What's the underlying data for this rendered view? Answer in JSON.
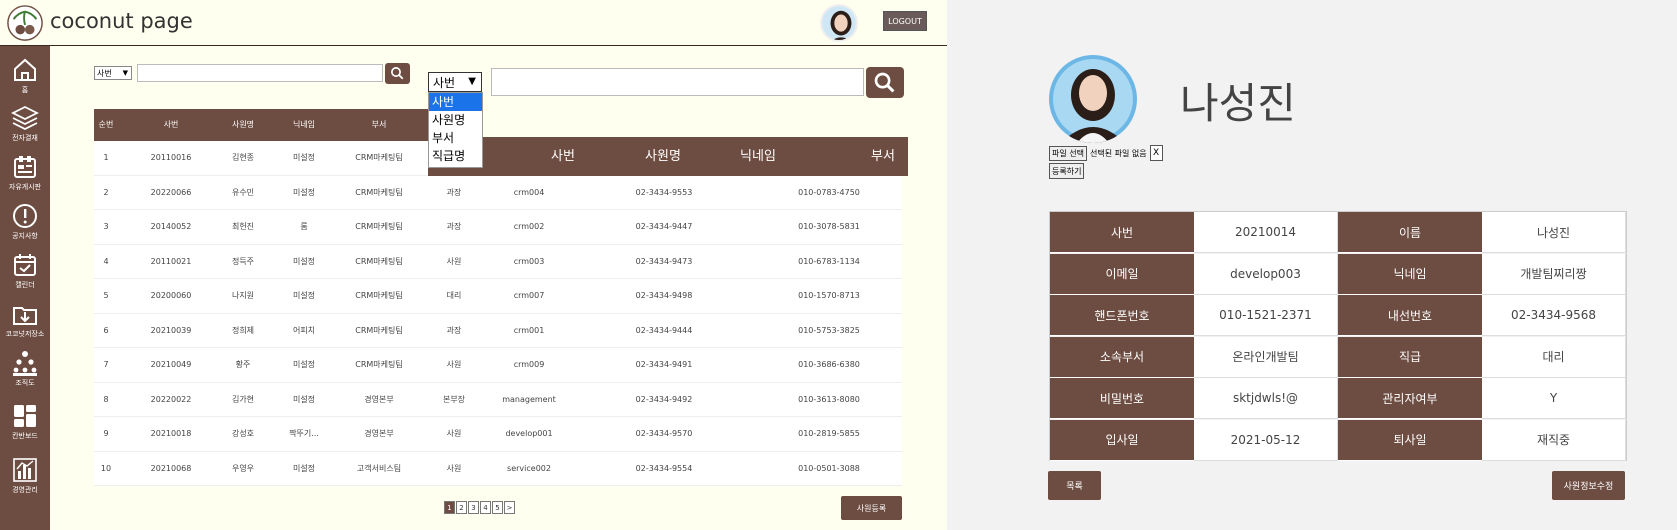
{
  "header": {
    "brand": "coconut page",
    "logout_label": "LOGOUT"
  },
  "sidebar": {
    "items": [
      {
        "label": "홈",
        "icon": "home-icon"
      },
      {
        "label": "전자결재",
        "icon": "layers-icon"
      },
      {
        "label": "자유게시판",
        "icon": "board-icon"
      },
      {
        "label": "공지사항",
        "icon": "alert-icon"
      },
      {
        "label": "캘린더",
        "icon": "calendar-icon"
      },
      {
        "label": "코코넛저장소",
        "icon": "folder-download-icon"
      },
      {
        "label": "조직도",
        "icon": "org-chart-icon"
      },
      {
        "label": "칸반보드",
        "icon": "kanban-icon"
      },
      {
        "label": "경영관리",
        "icon": "bar-chart-icon"
      }
    ]
  },
  "search": {
    "small_select_value": "사번",
    "big_select_value": "사번",
    "big_dropdown_options": [
      "사번",
      "사원명",
      "부서",
      "직급명"
    ]
  },
  "emp_table": {
    "head1": [
      "순번",
      "사번",
      "사원명",
      "닉네임",
      "부서"
    ],
    "head2": [
      "사번",
      "사원명",
      "닉네임",
      "부서"
    ],
    "rows": [
      [
        "1",
        "20110016",
        "김현종",
        "미설정",
        "CRM마케팅팀",
        "",
        "",
        "",
        ""
      ],
      [
        "2",
        "20220066",
        "유수민",
        "미설정",
        "CRM마케팅팀",
        "과장",
        "crm004",
        "02-3434-9553",
        "010-0783-4750"
      ],
      [
        "3",
        "20140052",
        "최헌진",
        "롬",
        "CRM마케팅팀",
        "과장",
        "crm002",
        "02-3434-9447",
        "010-3078-5831"
      ],
      [
        "4",
        "20110021",
        "정득주",
        "미설정",
        "CRM마케팅팀",
        "사원",
        "crm003",
        "02-3434-9473",
        "010-6783-1134"
      ],
      [
        "5",
        "20200060",
        "나지원",
        "미설정",
        "CRM마케팅팀",
        "대리",
        "crm007",
        "02-3434-9498",
        "010-1570-8713"
      ],
      [
        "6",
        "20210039",
        "정희제",
        "어피치",
        "CRM마케팅팀",
        "과장",
        "crm001",
        "02-3434-9444",
        "010-5753-3825"
      ],
      [
        "7",
        "20210049",
        "황주",
        "미설정",
        "CRM마케팅팀",
        "사원",
        "crm009",
        "02-3434-9491",
        "010-3686-6380"
      ],
      [
        "8",
        "20220022",
        "김가현",
        "미설정",
        "경영본부",
        "본부장",
        "management",
        "02-3434-9492",
        "010-3613-8080"
      ],
      [
        "9",
        "20210018",
        "강성호",
        "짝뚜기...",
        "경영본부",
        "사원",
        "develop001",
        "02-3434-9570",
        "010-2819-5855"
      ],
      [
        "10",
        "20210068",
        "우영우",
        "미설정",
        "고객서비스팀",
        "사원",
        "service002",
        "02-3434-9554",
        "010-0501-3088"
      ]
    ]
  },
  "pagination": {
    "pages": [
      "1",
      "2",
      "3",
      "4",
      "5",
      ">"
    ]
  },
  "register_label": "사원등록",
  "profile": {
    "name": "나성진",
    "file_button": "파일 선택",
    "file_status": "선택된 파일 없음",
    "file_clear": "X",
    "upload_label": "등록하기"
  },
  "detail": {
    "rows": [
      [
        "사번",
        "20210014",
        "이름",
        "나성진"
      ],
      [
        "이메일",
        "develop003",
        "닉네임",
        "개발팀찌리짱"
      ],
      [
        "핸드폰번호",
        "010-1521-2371",
        "내선번호",
        "02-3434-9568"
      ],
      [
        "소속부서",
        "온라인개발팀",
        "직급",
        "대리"
      ],
      [
        "비밀번호",
        "sktjdwls!@",
        "관리자여부",
        "Y"
      ],
      [
        "입사일",
        "2021-05-12",
        "퇴사일",
        "재직중"
      ]
    ]
  },
  "list_label": "목록",
  "edit_label": "사원정보수정",
  "colors": {
    "brand_brown": "#6d4c41",
    "left_bg": "#fffff0",
    "right_bg": "#f2f2f2"
  }
}
